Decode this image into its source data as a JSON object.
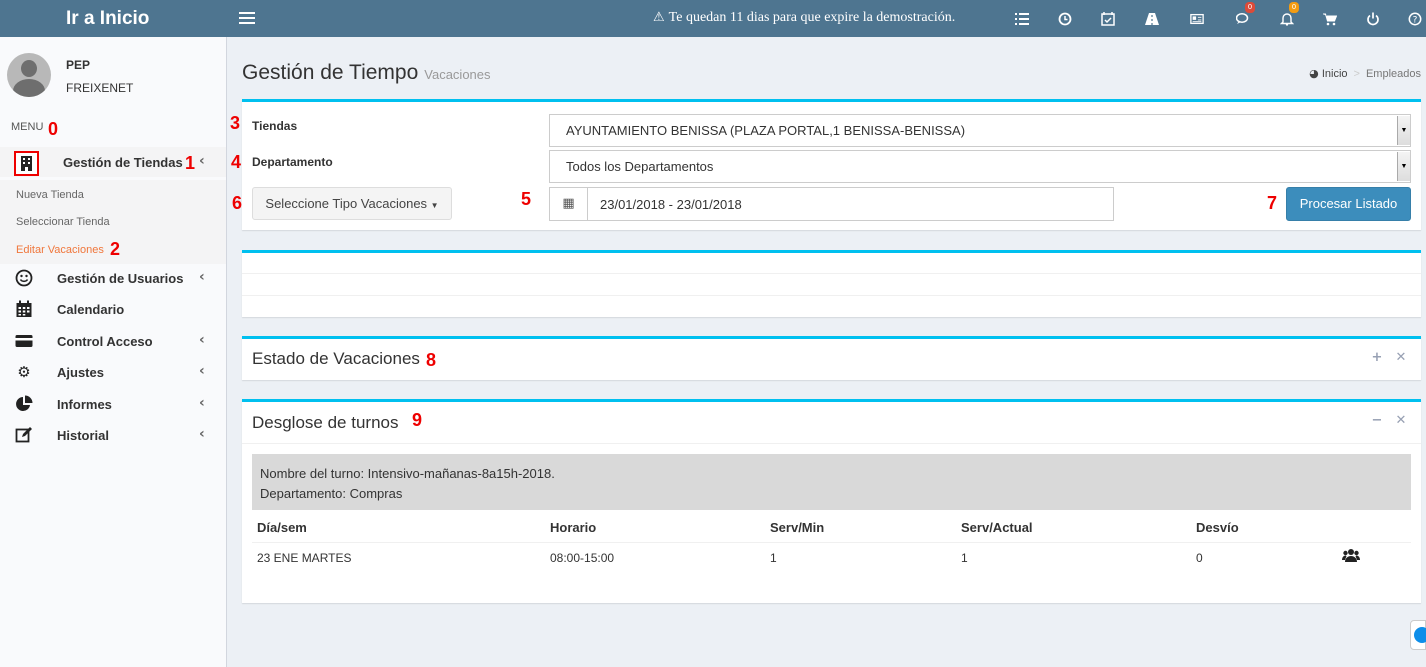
{
  "header": {
    "logo": "Ir a Inicio",
    "warning": "Te quedan 11 dias para que expire la demostración.",
    "icons": [
      "list-icon",
      "clock-icon",
      "calendar-check-icon",
      "road-icon",
      "newspaper-icon",
      "comments-icon",
      "bell-icon",
      "cart-icon",
      "power-icon",
      "help-icon"
    ],
    "badges": {
      "comments": "0",
      "bell": "0"
    }
  },
  "user": {
    "first": "PEP",
    "last": "FREIXENET"
  },
  "sidebar": {
    "menu_label": "MENU",
    "items": [
      {
        "label": "Gestión de Tiendas",
        "icon": "building-icon"
      },
      {
        "label": "Gestión de Usuarios",
        "icon": "smile-icon"
      },
      {
        "label": "Calendario",
        "icon": "calendar-icon"
      },
      {
        "label": "Control Acceso",
        "icon": "credit-card-icon"
      },
      {
        "label": "Ajustes",
        "icon": "gear-icon"
      },
      {
        "label": "Informes",
        "icon": "pie-chart-icon"
      },
      {
        "label": "Historial",
        "icon": "edit-icon"
      }
    ],
    "subitems": [
      "Nueva Tienda",
      "Seleccionar Tienda",
      "Editar Vacaciones"
    ]
  },
  "annotations": [
    "0",
    "1",
    "2",
    "3",
    "4",
    "5",
    "6",
    "7",
    "8",
    "9"
  ],
  "page": {
    "title": "Gestión de Tiempo",
    "subtitle": "Vacaciones",
    "breadcrumb": {
      "home": "Inicio",
      "current": "Empleados"
    }
  },
  "filters": {
    "tiendas_label": "Tiendas",
    "tienda_value": "AYUNTAMIENTO BENISSA (PLAZA PORTAL,1 BENISSA-BENISSA)",
    "departamento_label": "Departamento",
    "departamento_value": "Todos los Departamentos",
    "tipo_button": "Seleccione Tipo Vacaciones",
    "date_range": "23/01/2018 - 23/01/2018",
    "process_button": "Procesar Listado"
  },
  "estado": {
    "title": "Estado de Vacaciones"
  },
  "desglose": {
    "title": "Desglose de turnos",
    "turno": "Nombre del turno: Intensivo-mañanas-8a15h-2018.",
    "departamento": "Departamento: Compras",
    "columns": [
      "Día/sem",
      "Horario",
      "Serv/Min",
      "Serv/Actual",
      "Desvío"
    ],
    "rows": [
      [
        "23 ENE MARTES",
        "08:00-15:00",
        "1",
        "1",
        "0"
      ]
    ]
  },
  "colors": {
    "topbar": "#4e7590",
    "accent": "#00c0ef",
    "primary": "#3c8dbc",
    "active_sub": "#f0773c",
    "annotation": "#ee0000"
  }
}
